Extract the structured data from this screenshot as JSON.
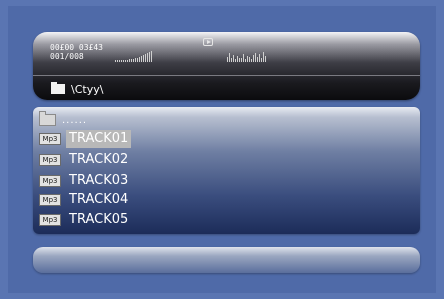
{
  "player": {
    "elapsed_time": "00£00 03£43",
    "track_counter": "001/008",
    "current_path": "\\Ctyy\\"
  },
  "file_list": {
    "parent_label": "......",
    "items": [
      {
        "type_badge": "Mp3",
        "name": "TRACK01",
        "selected": true
      },
      {
        "type_badge": "Mp3",
        "name": "TRACK02",
        "selected": false
      },
      {
        "type_badge": "Mp3",
        "name": "TRACK03",
        "selected": false
      },
      {
        "type_badge": "Mp3",
        "name": "TRACK04",
        "selected": false
      },
      {
        "type_badge": "Mp3",
        "name": "TRACK05",
        "selected": false
      }
    ]
  },
  "icons": {
    "play_status": "play-icon",
    "folder": "folder-icon",
    "parent_folder": "folder-up-icon",
    "file_type": "mp3-icon"
  },
  "colors": {
    "background": "#5a75b2",
    "selection": "#b8b8b8"
  }
}
